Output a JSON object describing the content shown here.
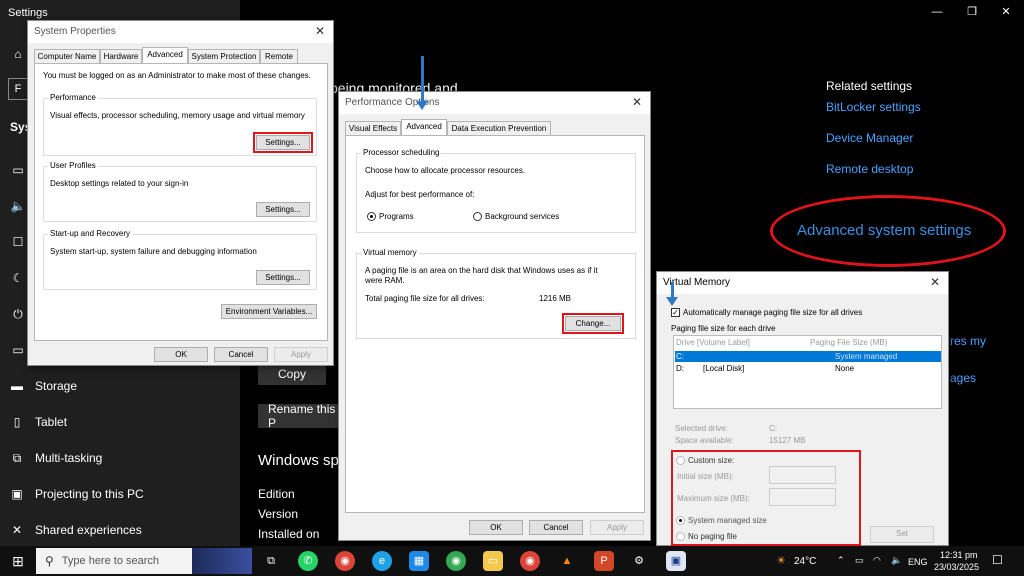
{
  "settings": {
    "title": "Settings",
    "sidebar_letter_f": "F",
    "sidebar_section": "Sys",
    "items": [
      {
        "label": "Storage"
      },
      {
        "label": "Tablet"
      },
      {
        "label": "Multi-tasking"
      },
      {
        "label": "Projecting to this PC"
      },
      {
        "label": "Shared experiences"
      }
    ],
    "main_partial_heading": "being monitored and",
    "copy_button": "Copy",
    "rename_button": "Rename this P",
    "windows_spec": "Windows sp",
    "edition": "Edition",
    "version": "Version",
    "installed_on": "Installed on",
    "related_settings": "Related settings",
    "related_links": [
      "BitLocker settings",
      "Device Manager",
      "Remote desktop"
    ],
    "advanced_system_settings": "Advanced system settings",
    "partial_link_1": "res my",
    "partial_link_2": "ages"
  },
  "system_properties": {
    "title": "System Properties",
    "tabs": [
      "Computer Name",
      "Hardware",
      "Advanced",
      "System Protection",
      "Remote"
    ],
    "admin_note": "You must be logged on as an Administrator to make most of these changes.",
    "performance_label": "Performance",
    "performance_desc": "Visual effects, processor scheduling, memory usage and virtual memory",
    "settings_button": "Settings...",
    "user_profiles_label": "User Profiles",
    "user_profiles_desc": "Desktop settings related to your sign-in",
    "startup_label": "Start-up and Recovery",
    "startup_desc": "System start-up, system failure and debugging information",
    "env_vars_button": "Environment Variables...",
    "ok": "OK",
    "cancel": "Cancel",
    "apply": "Apply"
  },
  "performance_options": {
    "title": "Performance Options",
    "tabs": [
      "Visual Effects",
      "Advanced",
      "Data Execution Prevention"
    ],
    "processor_scheduling": "Processor scheduling",
    "choose_text": "Choose how to allocate processor resources.",
    "adjust_text": "Adjust for best performance of:",
    "programs": "Programs",
    "background_services": "Background services",
    "virtual_memory": "Virtual memory",
    "vm_desc_1": "A paging file is an area on the hard disk that Windows uses as if it",
    "vm_desc_2": "were RAM.",
    "total_paging_label": "Total paging file size for all drives:",
    "total_paging_value": "1216 MB",
    "change_button": "Change...",
    "ok": "OK",
    "cancel": "Cancel",
    "apply": "Apply"
  },
  "virtual_memory": {
    "title": "Virtual Memory",
    "auto_manage": "Automatically manage paging file size for all drives",
    "paging_each_drive": "Paging file size for each drive",
    "col_drive": "Drive  [Volume Label]",
    "col_size": "Paging File Size (MB)",
    "rows": [
      {
        "drive": "C:",
        "label": "",
        "size": "System managed",
        "selected": true
      },
      {
        "drive": "D:",
        "label": "[Local Disk]",
        "size": "None",
        "selected": false
      }
    ],
    "selected_drive_label": "Selected drive:",
    "selected_drive_value": "C:",
    "space_available_label": "Space available:",
    "space_available_value": "15127 MB",
    "custom_size": "Custom size:",
    "initial_size": "Initial size (MB):",
    "maximum_size": "Maximum size (MB):",
    "system_managed_size": "System managed size",
    "no_paging_file": "No paging file",
    "set_button": "Set"
  },
  "taskbar": {
    "search_placeholder": "Type here to search",
    "weather": "24°C",
    "language": "ENG",
    "time": "12:31 pm",
    "date": "23/03/2025"
  },
  "colors": {
    "highlight_red": "#e0141c",
    "link_blue": "#4aa3ff",
    "arrow_blue": "#2f78c4",
    "selection_blue": "#0078d7"
  }
}
